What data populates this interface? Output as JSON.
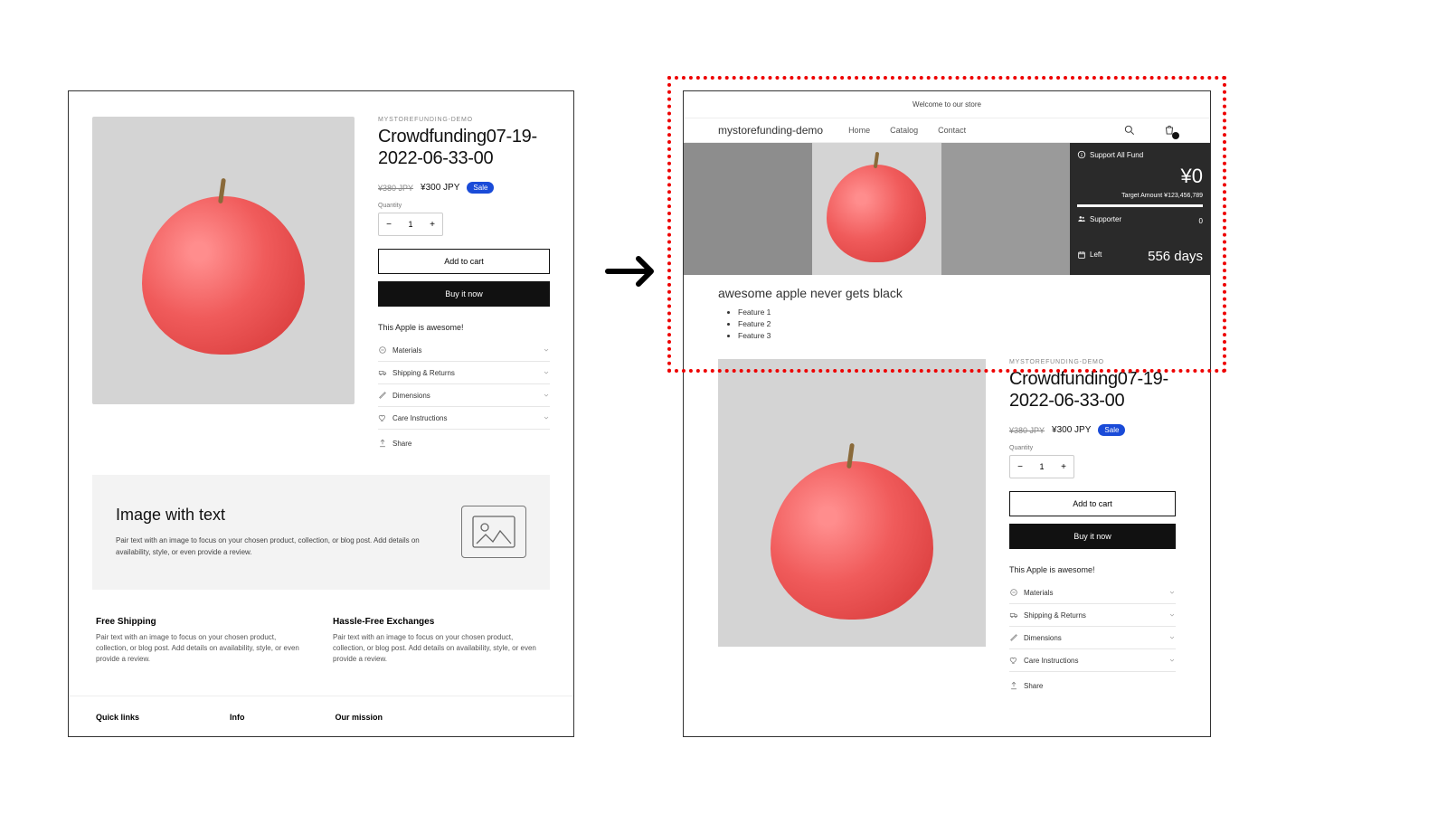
{
  "left": {
    "vendor": "MYSTOREFUNDING-DEMO",
    "title": "Crowdfunding07-19-2022-06-33-00",
    "price_old": "¥380 JPY",
    "price_new": "¥300 JPY",
    "sale": "Sale",
    "qty_label": "Quantity",
    "qty_value": "1",
    "add_cart": "Add to cart",
    "buy_now": "Buy it now",
    "desc": "This Apple is awesome!",
    "acc": [
      "Materials",
      "Shipping & Returns",
      "Dimensions",
      "Care Instructions"
    ],
    "share": "Share",
    "imgtext": {
      "title": "Image with text",
      "body": "Pair text with an image to focus on your chosen product, collection, or blog post. Add details on availability, style, or even provide a review."
    },
    "feat1_h": "Free Shipping",
    "feat2_h": "Hassle-Free Exchanges",
    "feat_body": "Pair text with an image to focus on your chosen product, collection, or blog post. Add details on availability, style, or even provide a review.",
    "foot": [
      "Quick links",
      "Info",
      "Our mission"
    ]
  },
  "right": {
    "topbar": "Welcome to our store",
    "brand": "mystorefunding-demo",
    "nav": [
      "Home",
      "Catalog",
      "Contact"
    ],
    "hero": {
      "support": "Support All Fund",
      "amount": "¥0",
      "target": "Target Amount ¥123,456,789",
      "supporter_label": "Supporter",
      "supporter_val": "0",
      "left_label": "Left",
      "days": "556 days"
    },
    "tagline": "awesome apple never gets black",
    "features": [
      "Feature 1",
      "Feature 2",
      "Feature 3"
    ],
    "prod": {
      "vendor": "MYSTOREFUNDING-DEMO",
      "title": "Crowdfunding07-19-2022-06-33-00",
      "price_old": "¥380 JPY",
      "price_new": "¥300 JPY",
      "sale": "Sale",
      "qty_label": "Quantity",
      "qty_value": "1",
      "add_cart": "Add to cart",
      "buy_now": "Buy it now",
      "desc": "This Apple is awesome!",
      "acc": [
        "Materials",
        "Shipping & Returns",
        "Dimensions",
        "Care Instructions"
      ],
      "share": "Share"
    }
  }
}
